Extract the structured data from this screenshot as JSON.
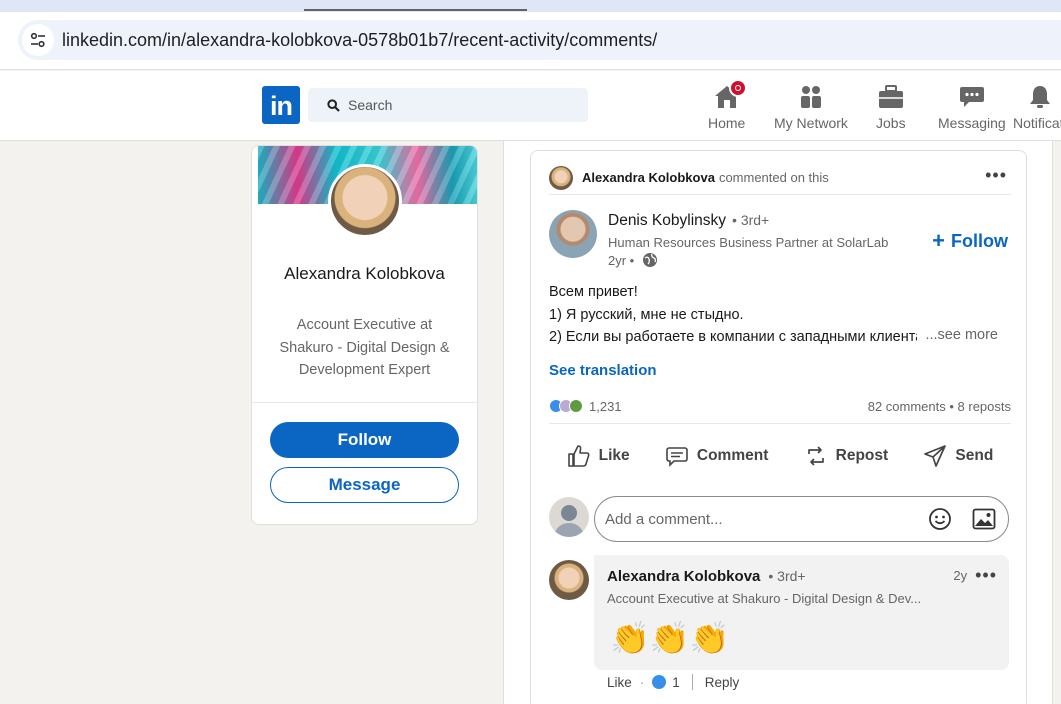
{
  "browser": {
    "url": "linkedin.com/in/alexandra-kolobkova-0578b01b7/recent-activity/comments/"
  },
  "nav": {
    "logo": "in",
    "search_placeholder": "Search",
    "items": [
      {
        "label": "Home",
        "icon": "home-icon"
      },
      {
        "label": "My Network",
        "icon": "network-icon"
      },
      {
        "label": "Jobs",
        "icon": "briefcase-icon"
      },
      {
        "label": "Messaging",
        "icon": "messaging-icon"
      },
      {
        "label": "Notificati",
        "icon": "bell-icon"
      }
    ]
  },
  "profile": {
    "name": "Alexandra Kolobkova",
    "headline": "Account Executive at Shakuro - Digital Design & Development Expert",
    "follow_label": "Follow",
    "message_label": "Message"
  },
  "post": {
    "activity_actor": "Alexandra Kolobkova",
    "activity_text": "commented on this",
    "author_name": "Denis Kobylinsky",
    "author_degree": "• 3rd+",
    "author_headline": "Human Resources Business Partner at SolarLab",
    "author_time": "2yr •",
    "follow_label": "Follow",
    "text_lines": [
      "Всем привет!",
      "1) Я русский, мне не стыдно.",
      "2) Если вы работаете в компании с западными клиентами"
    ],
    "see_more": "...see more",
    "see_translation": "See translation",
    "reaction_count": "1,231",
    "stats": "82 comments • 8 reposts",
    "actions": {
      "like": "Like",
      "comment": "Comment",
      "repost": "Repost",
      "send": "Send"
    },
    "comment_placeholder": "Add a comment..."
  },
  "comment": {
    "author": "Alexandra Kolobkova",
    "degree": "• 3rd+",
    "time": "2y",
    "headline": "Account Executive at Shakuro - Digital Design & Dev...",
    "emoji": "👏👏👏",
    "like_label": "Like",
    "like_count": "1",
    "reply_label": "Reply"
  },
  "colors": {
    "brand": "#0a66c2",
    "badge": "#cb112d",
    "background": "#f4f2ee"
  }
}
